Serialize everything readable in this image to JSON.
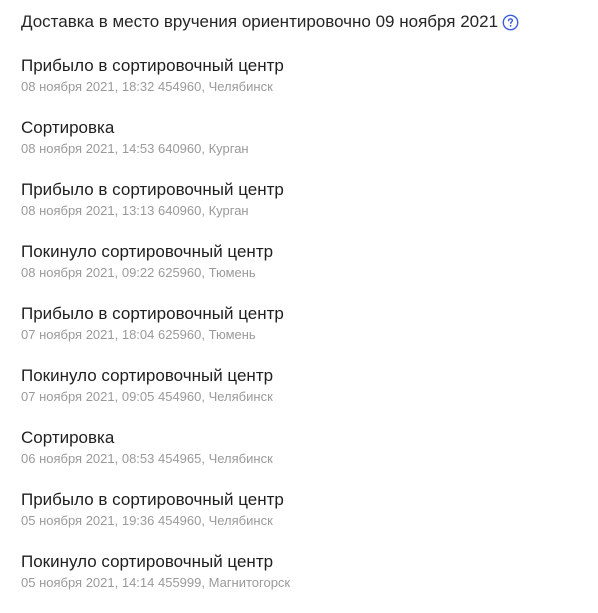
{
  "header": {
    "delivery_text": "Доставка в место вручения ориентировочно 09 ноября 2021",
    "help_icon": "question-circle-icon"
  },
  "colors": {
    "title": "#1f1f1f",
    "meta": "#9a9a9a",
    "accent": "#3b5bdb"
  },
  "events": [
    {
      "title": "Прибыло в сортировочный центр",
      "meta": "08 ноября 2021, 18:32 454960, Челябинск"
    },
    {
      "title": "Сортировка",
      "meta": "08 ноября 2021, 14:53 640960, Курган"
    },
    {
      "title": "Прибыло в сортировочный центр",
      "meta": "08 ноября 2021, 13:13 640960, Курган"
    },
    {
      "title": "Покинуло сортировочный центр",
      "meta": "08 ноября 2021, 09:22 625960, Тюмень"
    },
    {
      "title": "Прибыло в сортировочный центр",
      "meta": "07 ноября 2021, 18:04 625960, Тюмень"
    },
    {
      "title": "Покинуло сортировочный центр",
      "meta": "07 ноября 2021, 09:05 454960, Челябинск"
    },
    {
      "title": "Сортировка",
      "meta": "06 ноября 2021, 08:53 454965, Челябинск"
    },
    {
      "title": "Прибыло в сортировочный центр",
      "meta": "05 ноября 2021, 19:36 454960, Челябинск"
    },
    {
      "title": "Покинуло сортировочный центр",
      "meta": "05 ноября 2021, 14:14 455999, Магнитогорск"
    }
  ]
}
